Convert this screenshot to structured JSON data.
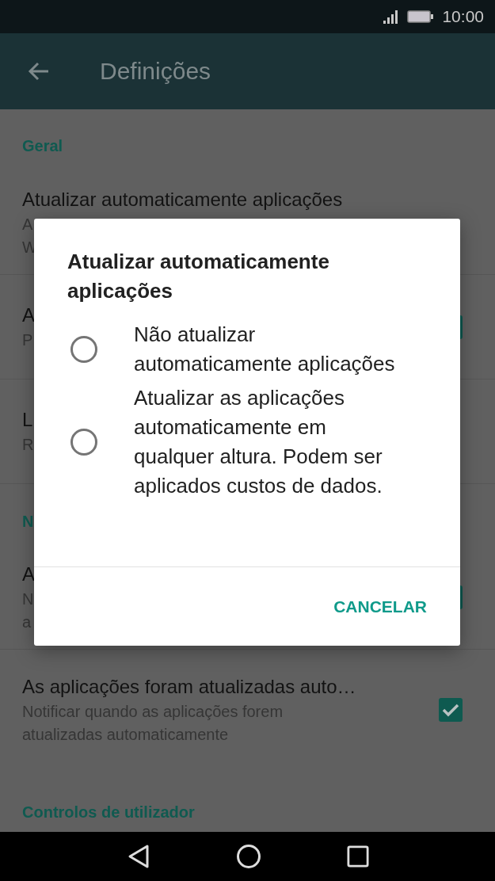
{
  "status_bar": {
    "time": "10:00"
  },
  "app_bar": {
    "title": "Definições"
  },
  "settings": [
    {
      "kind": "header",
      "text": "Geral"
    },
    {
      "kind": "item",
      "title": "Atualizar automaticamente aplicações",
      "subtitle_lines": [
        "A",
        "W"
      ]
    },
    {
      "kind": "item",
      "title": "A",
      "subtitle_lines": [
        "P"
      ],
      "checked": true
    },
    {
      "kind": "item",
      "title": "L",
      "subtitle_lines": [
        "R"
      ]
    },
    {
      "kind": "header",
      "text": "N"
    },
    {
      "kind": "item",
      "title": "A",
      "subtitle_lines": [
        "N",
        "a"
      ],
      "checked": true
    },
    {
      "kind": "item",
      "title": "As aplicações foram atualizadas auto…",
      "subtitle_lines": [
        "Notificar quando as aplicações forem",
        "atualizadas automaticamente"
      ],
      "checked": true
    },
    {
      "kind": "header",
      "text": "Controlos de utilizador"
    }
  ],
  "dialog": {
    "title": "Atualizar automaticamente aplicações",
    "options": [
      {
        "label": "Não atualizar automaticamente aplicações",
        "selected": false
      },
      {
        "label": "Atualizar as aplicações automaticamente em qualquer altura. Podem ser aplicados custos de dados.",
        "selected": false
      }
    ],
    "button": "CANCELAR"
  }
}
